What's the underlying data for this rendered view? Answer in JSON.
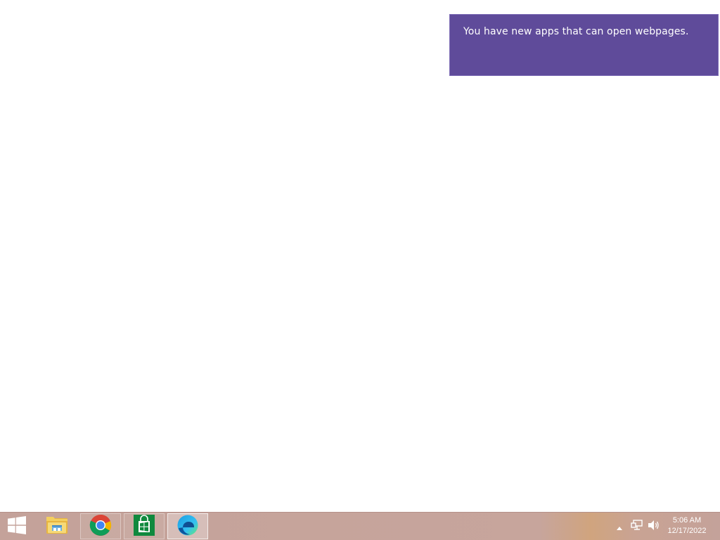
{
  "notification": {
    "message": "You have new apps that can open webpages.",
    "background": "#5f4b9a"
  },
  "taskbar": {
    "start_icon": "windows-logo-icon",
    "apps": [
      {
        "name": "File Explorer",
        "icon": "file-explorer-icon",
        "state": "pinned"
      },
      {
        "name": "Google Chrome",
        "icon": "chrome-icon",
        "state": "pinned"
      },
      {
        "name": "Store",
        "icon": "store-icon",
        "state": "pinned"
      },
      {
        "name": "Microsoft Edge",
        "icon": "edge-icon",
        "state": "active"
      }
    ],
    "tray": {
      "icons": [
        "show-hidden-icons-arrow-icon",
        "network-icon",
        "volume-icon"
      ]
    },
    "clock": {
      "time": "5:06 AM",
      "date": "12/17/2022"
    }
  }
}
